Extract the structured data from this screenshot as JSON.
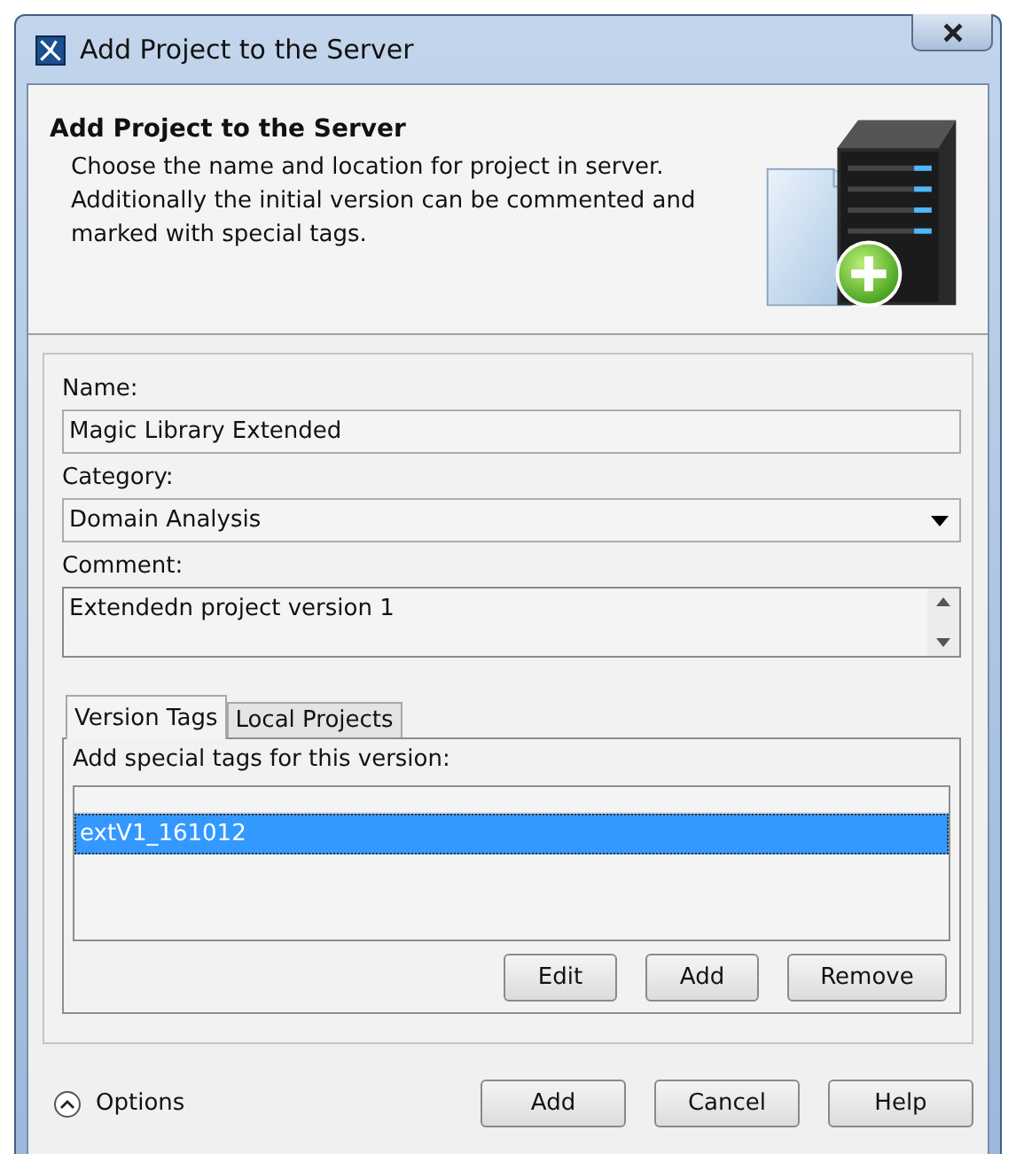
{
  "window": {
    "title": "Add Project to the Server"
  },
  "header": {
    "title": "Add Project to the Server",
    "description": "Choose the name and location for project in server.\nAdditionally the initial version can be commented and\nmarked with special tags."
  },
  "form": {
    "name_label": "Name:",
    "name_value": "Magic Library Extended",
    "category_label": "Category:",
    "category_value": "Domain Analysis",
    "comment_label": "Comment:",
    "comment_value": "Extendedn project version 1"
  },
  "tabs": [
    {
      "label": "Version Tags",
      "selected": true
    },
    {
      "label": "Local Projects",
      "selected": false
    }
  ],
  "tags_panel": {
    "hint": "Add special tags for this version:",
    "tags": [
      {
        "label": "extV1_161012",
        "selected": true
      }
    ],
    "buttons": [
      "Edit",
      "Add",
      "Remove"
    ]
  },
  "options_label": "Options",
  "buttons": [
    "Add",
    "Cancel",
    "Help"
  ]
}
